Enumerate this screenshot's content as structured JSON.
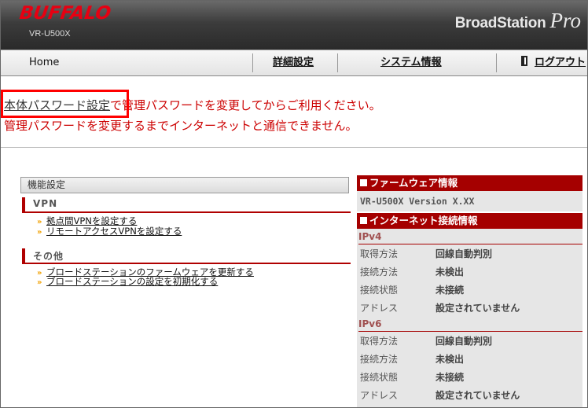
{
  "header": {
    "logo": "BUFFALO",
    "model": "VR-U500X",
    "brand_main": "BroadStation",
    "brand_pro": "Pro"
  },
  "nav": {
    "home": "Home",
    "advanced": "詳細設定",
    "system": "システム情報",
    "logout": "ログアウト"
  },
  "warning": {
    "link": "本体パスワード設定",
    "line1_rest": "で管理パスワードを変更してからご利用ください。",
    "line2": "管理パスワードを変更するまでインターネットと通信できません。"
  },
  "functions": {
    "header": "機能設定",
    "sections": [
      {
        "title": "VPN",
        "links": [
          "拠点間VPNを設定する",
          "リモートアクセスVPNを設定する"
        ]
      },
      {
        "title": "その他",
        "links": [
          "ブロードステーションのファームウェアを更新する",
          "ブロードステーションの設定を初期化する"
        ]
      }
    ]
  },
  "firmware": {
    "title": "ファームウェア情報",
    "version": "VR-U500X Version X.XX"
  },
  "internet": {
    "title": "インターネット接続情報",
    "ipv4": {
      "label": "IPv4",
      "rows": [
        {
          "k": "取得方法",
          "v": "回線自動判別"
        },
        {
          "k": "接続方法",
          "v": "未検出"
        },
        {
          "k": "接続状態",
          "v": "未接続"
        },
        {
          "k": "アドレス",
          "v": "設定されていません"
        }
      ]
    },
    "ipv6": {
      "label": "IPv6",
      "rows": [
        {
          "k": "取得方法",
          "v": "回線自動判別"
        },
        {
          "k": "接続方法",
          "v": "未検出"
        },
        {
          "k": "接続状態",
          "v": "未接続"
        },
        {
          "k": "アドレス",
          "v": "設定されていません"
        }
      ]
    }
  }
}
